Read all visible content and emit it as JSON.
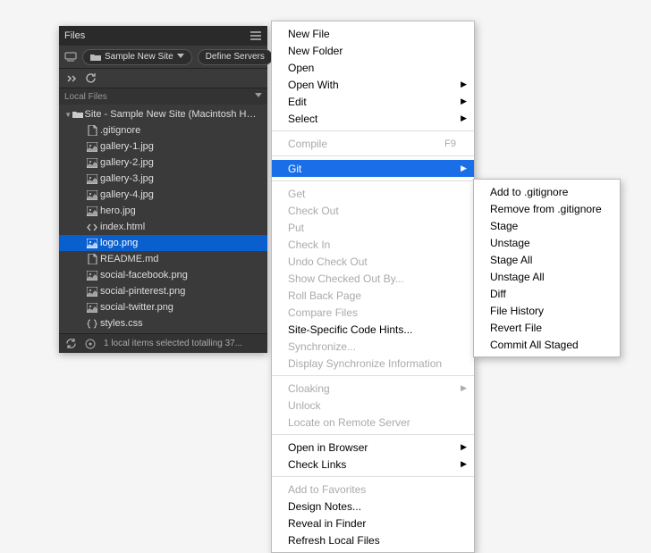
{
  "panel": {
    "title": "Files",
    "site_name": "Sample New Site",
    "define_servers": "Define Servers",
    "section_label": "Local Files",
    "root_label": "Site - Sample New Site (Macintosh HD:Users:...",
    "files": [
      {
        "name": ".gitignore",
        "icon": "file"
      },
      {
        "name": "gallery-1.jpg",
        "icon": "image"
      },
      {
        "name": "gallery-2.jpg",
        "icon": "image"
      },
      {
        "name": "gallery-3.jpg",
        "icon": "image"
      },
      {
        "name": "gallery-4.jpg",
        "icon": "image"
      },
      {
        "name": "hero.jpg",
        "icon": "image"
      },
      {
        "name": "index.html",
        "icon": "code"
      },
      {
        "name": "logo.png",
        "icon": "image",
        "selected": true
      },
      {
        "name": "README.md",
        "icon": "file"
      },
      {
        "name": "social-facebook.png",
        "icon": "image"
      },
      {
        "name": "social-pinterest.png",
        "icon": "image"
      },
      {
        "name": "social-twitter.png",
        "icon": "image"
      },
      {
        "name": "styles.css",
        "icon": "css"
      }
    ],
    "status": "1 local items selected totalling 37..."
  },
  "context_menu": [
    {
      "label": "New File"
    },
    {
      "label": "New Folder"
    },
    {
      "label": "Open"
    },
    {
      "label": "Open With",
      "submenu": true
    },
    {
      "label": "Edit",
      "submenu": true
    },
    {
      "label": "Select",
      "submenu": true
    },
    {
      "sep": true
    },
    {
      "label": "Compile",
      "shortcut": "F9",
      "disabled": true
    },
    {
      "sep": true
    },
    {
      "label": "Git",
      "submenu": true,
      "highlighted": true
    },
    {
      "sep": true
    },
    {
      "label": "Get",
      "disabled": true
    },
    {
      "label": "Check Out",
      "disabled": true
    },
    {
      "label": "Put",
      "disabled": true
    },
    {
      "label": "Check In",
      "disabled": true
    },
    {
      "label": "Undo Check Out",
      "disabled": true
    },
    {
      "label": "Show Checked Out By...",
      "disabled": true
    },
    {
      "label": "Roll Back Page",
      "disabled": true
    },
    {
      "label": "Compare Files",
      "disabled": true
    },
    {
      "label": "Site-Specific Code Hints..."
    },
    {
      "label": "Synchronize...",
      "disabled": true
    },
    {
      "label": "Display Synchronize Information",
      "disabled": true
    },
    {
      "sep": true
    },
    {
      "label": "Cloaking",
      "submenu": true,
      "disabled": true
    },
    {
      "label": "Unlock",
      "disabled": true
    },
    {
      "label": "Locate on Remote Server",
      "disabled": true
    },
    {
      "sep": true
    },
    {
      "label": "Open in Browser",
      "submenu": true
    },
    {
      "label": "Check Links",
      "submenu": true
    },
    {
      "sep": true
    },
    {
      "label": "Add to Favorites",
      "disabled": true
    },
    {
      "label": "Design Notes..."
    },
    {
      "label": "Reveal in Finder"
    },
    {
      "label": "Refresh Local Files"
    }
  ],
  "git_submenu": [
    {
      "label": "Add to .gitignore"
    },
    {
      "label": "Remove from .gitignore"
    },
    {
      "label": "Stage"
    },
    {
      "label": "Unstage"
    },
    {
      "label": "Stage All"
    },
    {
      "label": "Unstage All"
    },
    {
      "label": "Diff"
    },
    {
      "label": "File History"
    },
    {
      "label": "Revert File"
    },
    {
      "label": "Commit All Staged"
    }
  ]
}
